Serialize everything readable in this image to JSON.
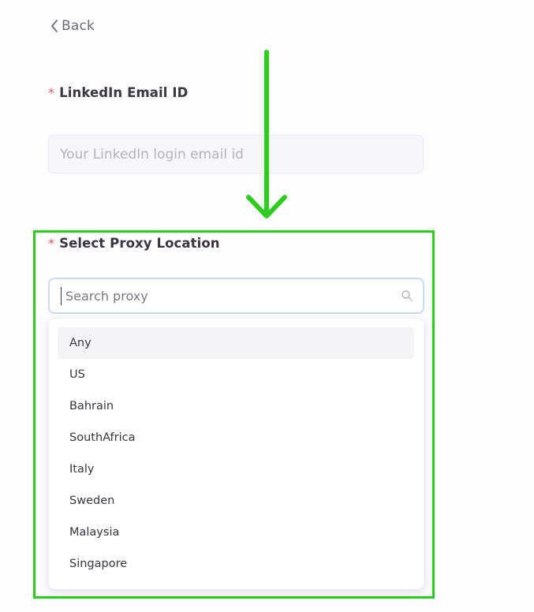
{
  "nav": {
    "back_label": "Back"
  },
  "email_field": {
    "required_mark": "*",
    "label": "LinkedIn Email ID",
    "placeholder": "Your LinkedIn login email id"
  },
  "proxy_field": {
    "required_mark": "*",
    "label": "Select Proxy Location",
    "search_placeholder": "Search proxy",
    "options": [
      {
        "label": "Any",
        "highlighted": true
      },
      {
        "label": "US"
      },
      {
        "label": "Bahrain"
      },
      {
        "label": "SouthAfrica"
      },
      {
        "label": "Italy"
      },
      {
        "label": "Sweden"
      },
      {
        "label": "Malaysia"
      },
      {
        "label": "Singapore"
      }
    ]
  },
  "colors": {
    "annotation_green": "#2ecc1f",
    "required_red": "#ea5455",
    "focus_border": "#c9dcf7"
  },
  "icons": {
    "back": "chevron-left-icon",
    "search": "magnifier-icon",
    "annotation": "down-arrow-icon"
  }
}
